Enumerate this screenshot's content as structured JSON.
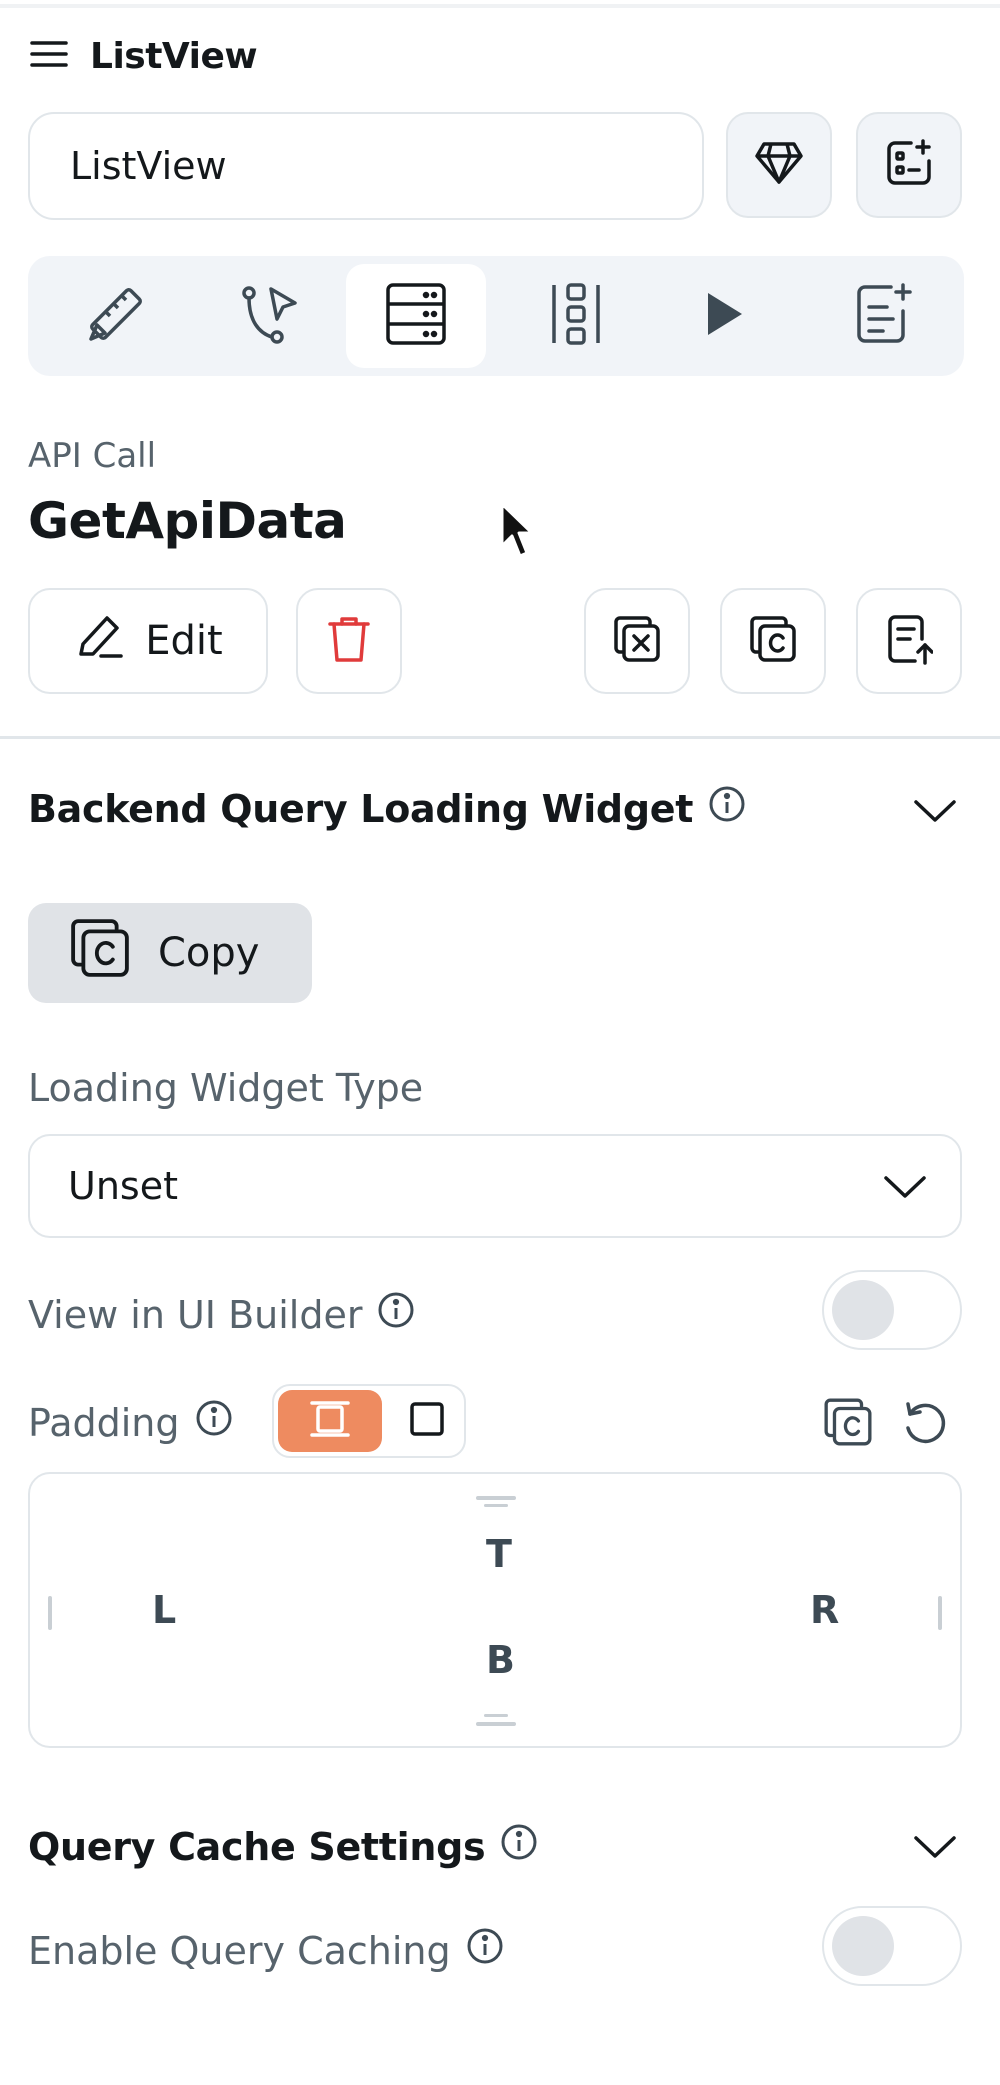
{
  "header": {
    "title": "ListView",
    "menu_icon": "hamburger-icon"
  },
  "name_input": {
    "value": "ListView"
  },
  "header_buttons": [
    "diamond-icon",
    "add-widget-icon"
  ],
  "tabs": [
    {
      "icon": "ruler-pencil-icon",
      "active": false
    },
    {
      "icon": "action-flow-icon",
      "active": false
    },
    {
      "icon": "backend-query-icon",
      "active": true
    },
    {
      "icon": "layout-icon",
      "active": false
    },
    {
      "icon": "play-icon",
      "active": false
    },
    {
      "icon": "document-add-icon",
      "active": false
    }
  ],
  "query": {
    "type_label": "API Call",
    "name": "GetApiData",
    "edit_label": "Edit"
  },
  "loading_widget": {
    "title": "Backend Query Loading Widget",
    "copy_label": "Copy",
    "type_label": "Loading Widget Type",
    "type_value": "Unset",
    "view_in_builder_label": "View in UI Builder",
    "view_in_builder_on": false,
    "padding_label": "Padding",
    "padding": {
      "top": "T",
      "left": "L",
      "right": "R",
      "bottom": "B"
    }
  },
  "cache": {
    "title": "Query Cache Settings",
    "enable_label": "Enable Query Caching",
    "enabled": false
  },
  "colors": {
    "accent": "#ee8b60",
    "delete": "#e03b3b",
    "surface": "#f1f4f8",
    "border": "#e1e6ea"
  }
}
